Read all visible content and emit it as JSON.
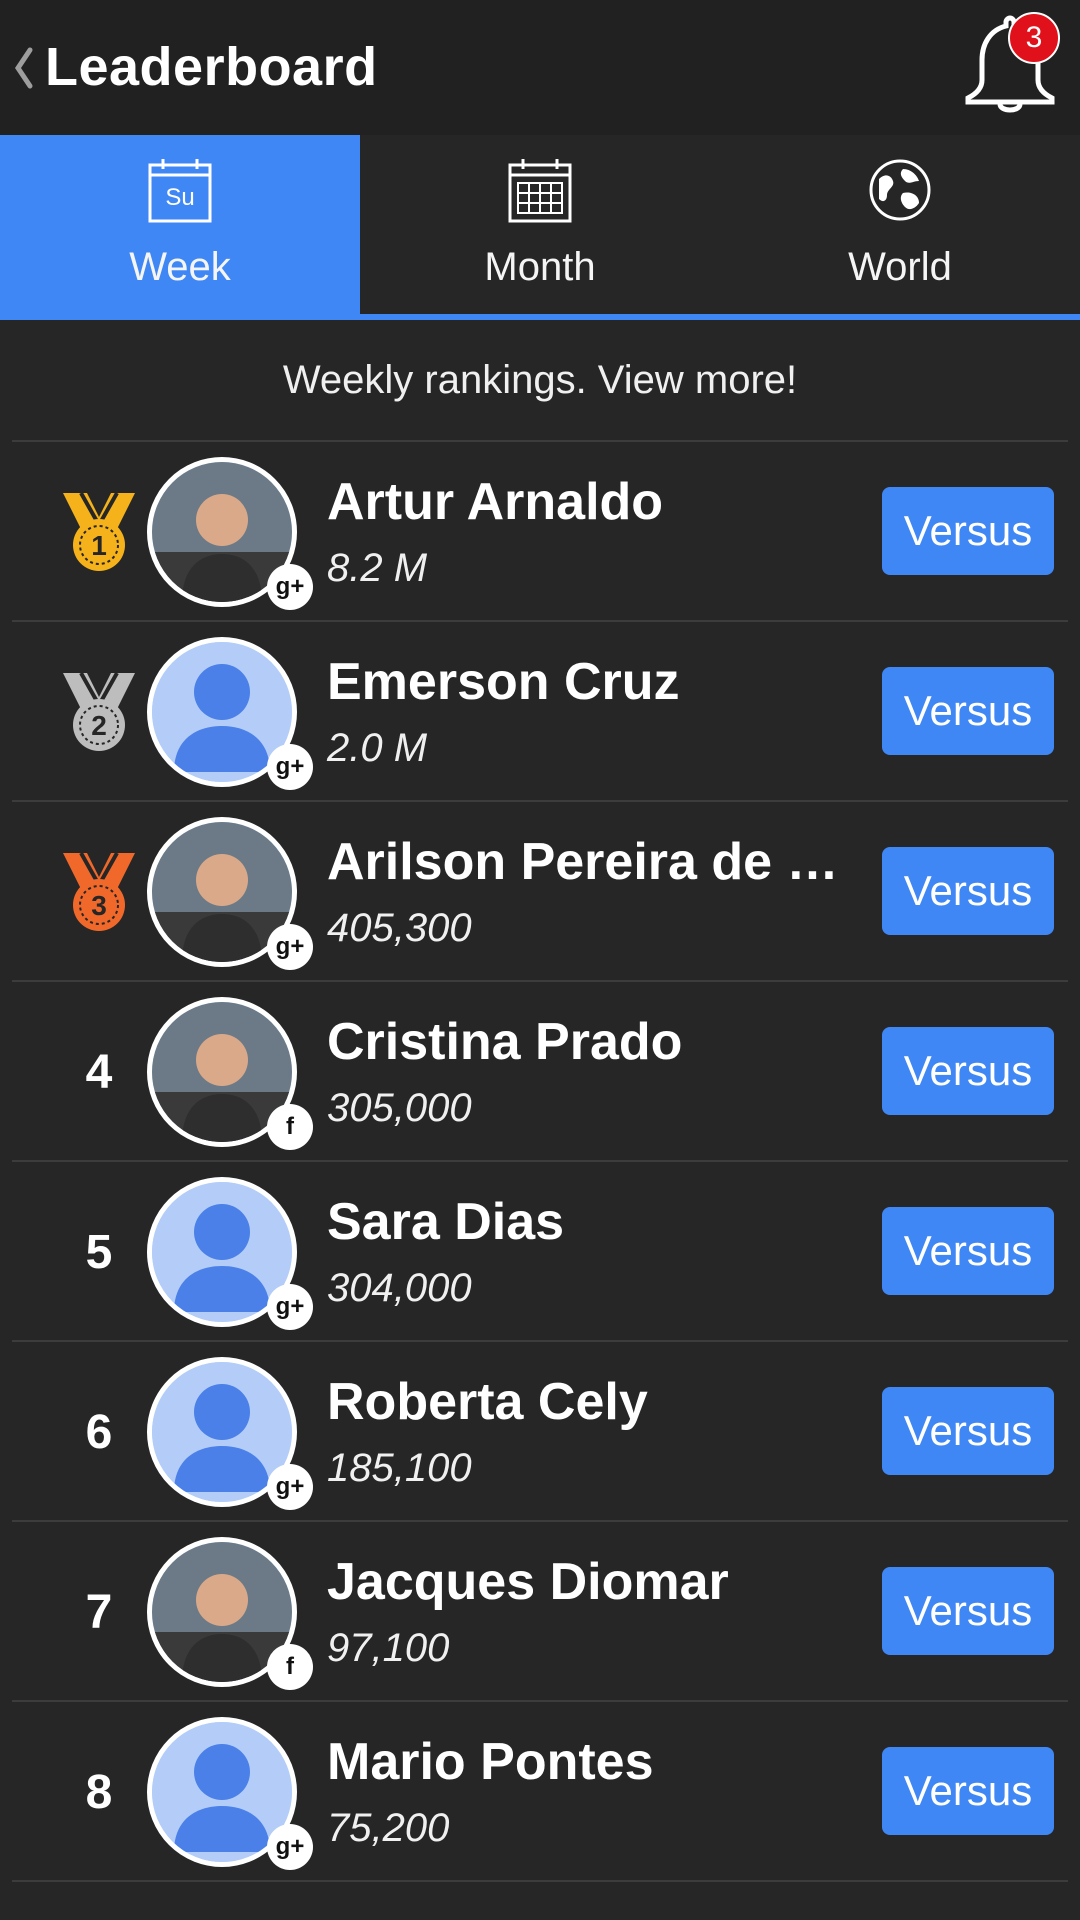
{
  "header": {
    "title": "Leaderboard",
    "back_icon": "chevron-left-icon",
    "bell_icon": "bell-icon",
    "notification_count": "3"
  },
  "tabs": [
    {
      "label": "Week",
      "icon": "calendar-sunday-icon",
      "icon_text": "Su",
      "active": true
    },
    {
      "label": "Month",
      "icon": "calendar-grid-icon",
      "active": false
    },
    {
      "label": "World",
      "icon": "globe-icon",
      "active": false
    }
  ],
  "subtitle": "Weekly rankings. View more!",
  "colors": {
    "accent": "#3f87f5",
    "background": "#262626",
    "header_background": "#212121",
    "badge_red": "#e0111b",
    "gold": "#f5b21b",
    "silver": "#bdbdbd",
    "bronze": "#f0692b"
  },
  "rows": [
    {
      "rank": "1",
      "medal": "gold",
      "name": "Artur Arnaldo",
      "score": "8.2 M",
      "social": "g+",
      "avatar": "photo",
      "button": "Versus"
    },
    {
      "rank": "2",
      "medal": "silver",
      "name": "Emerson Cruz",
      "score": "2.0 M",
      "social": "g+",
      "avatar": "placeholder",
      "button": "Versus"
    },
    {
      "rank": "3",
      "medal": "bronze",
      "name": "Arilson Pereira de M…",
      "score": "405,300",
      "social": "g+",
      "avatar": "photo",
      "button": "Versus"
    },
    {
      "rank": "4",
      "medal": "",
      "name": "Cristina Prado",
      "score": "305,000",
      "social": "f",
      "avatar": "photo",
      "button": "Versus"
    },
    {
      "rank": "5",
      "medal": "",
      "name": "Sara Dias",
      "score": "304,000",
      "social": "g+",
      "avatar": "placeholder",
      "button": "Versus"
    },
    {
      "rank": "6",
      "medal": "",
      "name": "Roberta Cely",
      "score": "185,100",
      "social": "g+",
      "avatar": "placeholder",
      "button": "Versus"
    },
    {
      "rank": "7",
      "medal": "",
      "name": "Jacques Diomar",
      "score": "97,100",
      "social": "f",
      "avatar": "photo",
      "button": "Versus"
    },
    {
      "rank": "8",
      "medal": "",
      "name": "Mario Pontes",
      "score": "75,200",
      "social": "g+",
      "avatar": "placeholder",
      "button": "Versus"
    }
  ]
}
